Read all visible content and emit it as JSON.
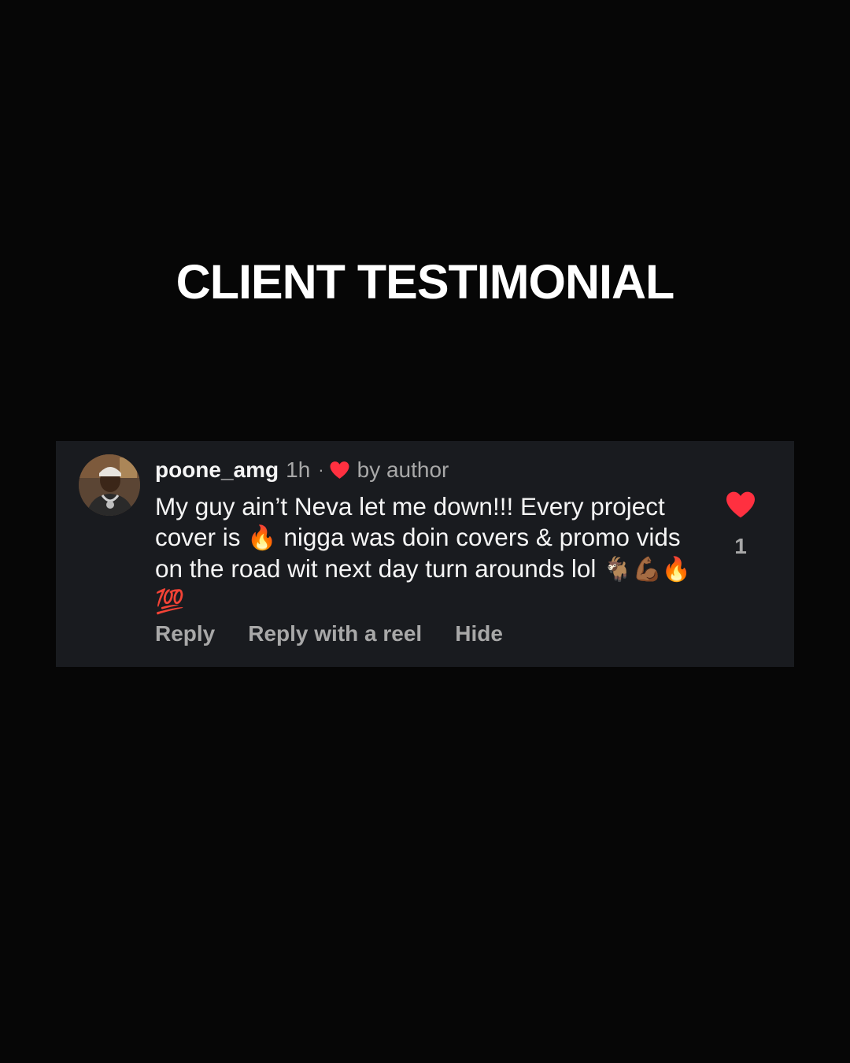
{
  "headline": "CLIENT TESTIMONIAL",
  "comment": {
    "username": "poone_amg",
    "time": "1h",
    "separator": "·",
    "liked_by_label": "by author",
    "text_parts": [
      "My guy ain’t Neva let me down!!! Every project cover is ",
      "🔥",
      " nigga was doin covers & promo vids on the road wit next day turn arounds lol ",
      "🐐💪🏾🔥💯"
    ],
    "like_count": "1",
    "actions": {
      "reply": "Reply",
      "reply_reel": "Reply with a reel",
      "hide": "Hide"
    }
  },
  "colors": {
    "background": "#060606",
    "card": "#191b1f",
    "heart": "#ff3040",
    "muted_text": "#a8a8a8"
  },
  "icons": {
    "liked_by_author": "heart-icon",
    "like": "heart-filled-icon",
    "avatar": "profile-photo"
  }
}
